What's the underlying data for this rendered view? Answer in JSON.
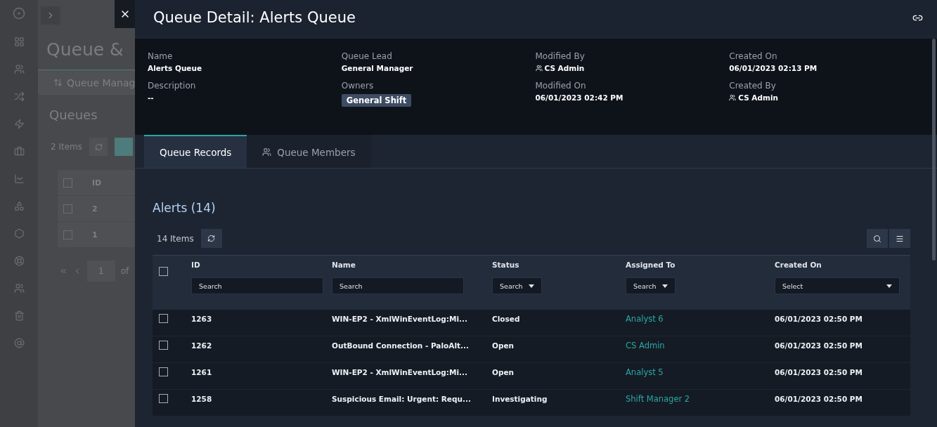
{
  "background_app": {
    "page_title": "Queue &",
    "tab": "Queue Manag",
    "section_title": "Queues",
    "item_count": "2 Items",
    "table": {
      "header_checked": false,
      "columns": [
        "ID"
      ],
      "rows": [
        {
          "id": "2",
          "checked": false
        },
        {
          "id": "1",
          "checked": false
        }
      ]
    },
    "pagination": {
      "page": "1",
      "of_label": "of"
    }
  },
  "drawer": {
    "title": "Queue Detail: Alerts Queue",
    "fields": [
      {
        "label": "Name",
        "value": "Alerts Queue",
        "kind": "text"
      },
      {
        "label": "Queue Lead",
        "value": "General Manager",
        "kind": "text"
      },
      {
        "label": "Modified By",
        "value": "CS Admin",
        "kind": "user"
      },
      {
        "label": "Created On",
        "value": "06/01/2023 02:13 PM",
        "kind": "text"
      },
      {
        "label": "Description",
        "value": "--",
        "kind": "text"
      },
      {
        "label": "Owners",
        "value": "General Shift",
        "kind": "tag"
      },
      {
        "label": "Modified On",
        "value": "06/01/2023 02:42 PM",
        "kind": "text"
      },
      {
        "label": "Created By",
        "value": "CS Admin",
        "kind": "user"
      }
    ],
    "tabs": [
      {
        "label": "Queue Records",
        "selected": true,
        "kind": "plain"
      },
      {
        "label": "Queue Members",
        "selected": false,
        "kind": "members"
      }
    ],
    "records": {
      "title": "Alerts (14)",
      "item_count": "14 Items",
      "select_all_checked": false,
      "columns": [
        {
          "label": "ID",
          "filter": "Search",
          "kind": "text"
        },
        {
          "label": "Name",
          "filter": "Search",
          "kind": "text"
        },
        {
          "label": "Status",
          "filter": "Search",
          "kind": "dropdown"
        },
        {
          "label": "Assigned To",
          "filter": "Search",
          "kind": "dropdown"
        },
        {
          "label": "Created On",
          "filter": "Select",
          "kind": "wide-dropdown"
        }
      ],
      "rows": [
        {
          "checked": false,
          "id": "1263",
          "name": "WIN-EP2 - XmlWinEventLog:Mi...",
          "status": "Closed",
          "assigned_to": "Analyst 6",
          "created_on": "06/01/2023 02:50 PM"
        },
        {
          "checked": false,
          "id": "1262",
          "name": "OutBound Connection - PaloAlt...",
          "status": "Open",
          "assigned_to": "CS Admin",
          "created_on": "06/01/2023 02:50 PM"
        },
        {
          "checked": false,
          "id": "1261",
          "name": "WIN-EP2 - XmlWinEventLog:Mi...",
          "status": "Open",
          "assigned_to": "Analyst 5",
          "created_on": "06/01/2023 02:50 PM"
        },
        {
          "checked": false,
          "id": "1258",
          "name": "Suspicious Email: Urgent: Requ...",
          "status": "Investigating",
          "assigned_to": "Shift Manager 2",
          "created_on": "06/01/2023 02:50 PM"
        }
      ]
    }
  }
}
